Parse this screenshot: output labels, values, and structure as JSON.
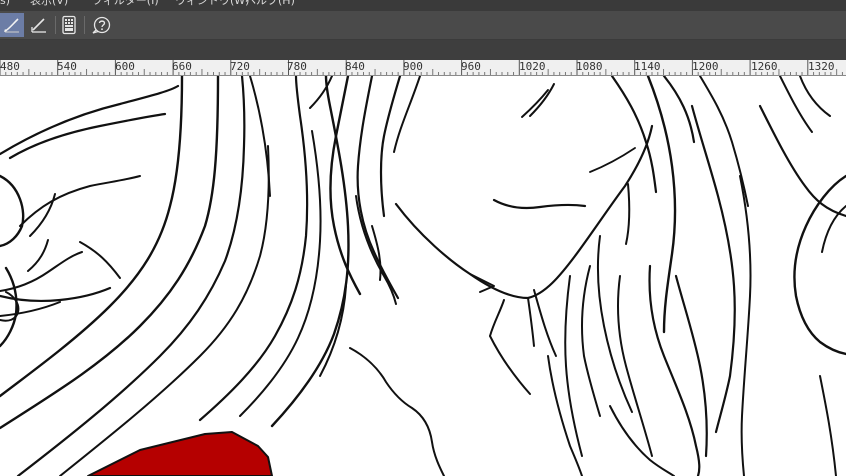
{
  "app": {
    "menu": [
      {
        "label": "s)"
      },
      {
        "label": "表示(V)"
      },
      {
        "label": "フィルター(I)"
      },
      {
        "label": "ウィンドウ(W)"
      },
      {
        "label": "ヘルプ(H)"
      }
    ]
  },
  "toolbar": {
    "tools": [
      {
        "icon": "pen-tool-icon",
        "active": true
      },
      {
        "icon": "ruler-pen-icon",
        "active": false
      },
      {
        "icon": "device-panel-icon",
        "active": false
      },
      {
        "icon": "help-icon",
        "active": false
      }
    ],
    "accent": "#6c7da6"
  },
  "ruler": {
    "labels": [
      "480",
      "540",
      "600",
      "660",
      "720",
      "780",
      "840",
      "900",
      "960",
      "1020",
      "1080",
      "1140",
      "1200",
      "1260",
      "1320"
    ]
  },
  "canvas": {
    "fill_color": "#b50000",
    "line_color": "#111111"
  }
}
